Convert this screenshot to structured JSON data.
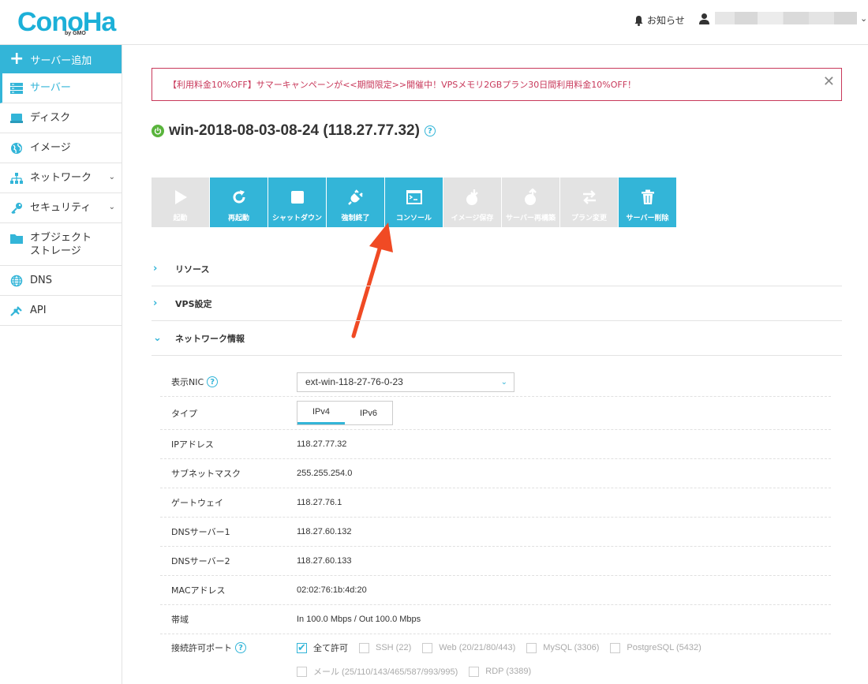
{
  "header": {
    "logo_text": "ConoHa",
    "logo_by": "by GMO",
    "notice_label": "お知らせ",
    "user_caret": "⌄"
  },
  "sidebar": {
    "add_label": "サーバー追加",
    "items": [
      {
        "label": "サーバー",
        "icon": "server-icon",
        "active": true
      },
      {
        "label": "ディスク",
        "icon": "disk-icon"
      },
      {
        "label": "イメージ",
        "icon": "globe-image-icon"
      },
      {
        "label": "ネットワーク",
        "icon": "network-icon",
        "chevron": "⌄"
      },
      {
        "label": "セキュリティ",
        "icon": "key-icon",
        "chevron": "⌄"
      },
      {
        "label": "オブジェクト\nストレージ",
        "icon": "folder-icon"
      },
      {
        "label": "DNS",
        "icon": "dns-globe-icon"
      },
      {
        "label": "API",
        "icon": "api-icon"
      }
    ]
  },
  "banner": {
    "text": "【利用料金10%OFF】サマーキャンペーンが<<期間限定>>開催中！VPSメモリ2GBプラン30日間利用料金10%OFF！",
    "close": "✕"
  },
  "server": {
    "title": "win-2018-08-03-08-24 (118.27.77.32)",
    "help": "?"
  },
  "toolbar": {
    "buttons": [
      {
        "label": "起動",
        "icon": "play-icon",
        "enabled": false
      },
      {
        "label": "再起動",
        "icon": "restart-icon",
        "enabled": true
      },
      {
        "label": "シャットダウン",
        "icon": "stop-icon",
        "enabled": true
      },
      {
        "label": "強制終了",
        "icon": "plug-icon",
        "enabled": true
      },
      {
        "label": "コンソール",
        "icon": "console-icon",
        "enabled": true
      },
      {
        "label": "イメージ保存",
        "icon": "image-save-icon",
        "enabled": false
      },
      {
        "label": "サーバー再構築",
        "icon": "rebuild-icon",
        "enabled": false
      },
      {
        "label": "プラン変更",
        "icon": "plan-change-icon",
        "enabled": false
      },
      {
        "label": "サーバー削除",
        "icon": "trash-icon",
        "enabled": true
      }
    ]
  },
  "sections": {
    "resource": "リソース",
    "vps": "VPS設定",
    "network": "ネットワーク情報",
    "chev_right": "›",
    "chev_down": "⌄"
  },
  "network": {
    "nic_label": "表示NIC",
    "nic_value": "ext-win-118-27-76-0-23",
    "type_label": "タイプ",
    "type_options": [
      "IPv4",
      "IPv6"
    ],
    "rows": [
      {
        "key": "IPアドレス",
        "value": "118.27.77.32"
      },
      {
        "key": "サブネットマスク",
        "value": "255.255.254.0"
      },
      {
        "key": "ゲートウェイ",
        "value": "118.27.76.1"
      },
      {
        "key": "DNSサーバー1",
        "value": "118.27.60.132"
      },
      {
        "key": "DNSサーバー2",
        "value": "118.27.60.133"
      },
      {
        "key": "MACアドレス",
        "value": "02:02:76:1b:4d:20"
      },
      {
        "key": "帯域",
        "value": "In 100.0 Mbps / Out 100.0 Mbps"
      }
    ],
    "ports_label": "接続許可ポート",
    "ports": [
      {
        "label": "全て許可",
        "checked": true
      },
      {
        "label": "SSH (22)",
        "checked": false
      },
      {
        "label": "Web (20/21/80/443)",
        "checked": false
      },
      {
        "label": "MySQL (3306)",
        "checked": false
      },
      {
        "label": "PostgreSQL (5432)",
        "checked": false
      },
      {
        "label": "メール (25/110/143/465/587/993/995)",
        "checked": false
      },
      {
        "label": "RDP (3389)",
        "checked": false
      }
    ]
  },
  "colors": {
    "accent": "#33b5d8",
    "disabled": "#e3e3e3",
    "banner": "#c8385a",
    "power": "#59b43c",
    "arrow": "#f04a24"
  }
}
